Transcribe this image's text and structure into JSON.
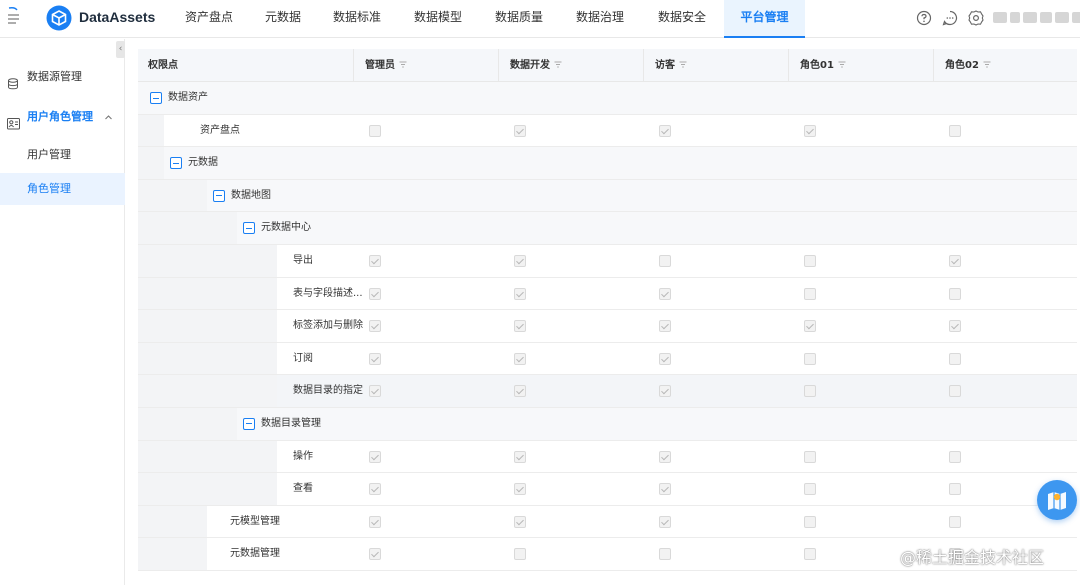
{
  "app": {
    "brand": "DataAssets"
  },
  "nav": {
    "tabs": [
      {
        "label": "资产盘点"
      },
      {
        "label": "元数据"
      },
      {
        "label": "数据标准"
      },
      {
        "label": "数据模型"
      },
      {
        "label": "数据质量"
      },
      {
        "label": "数据治理"
      },
      {
        "label": "数据安全"
      },
      {
        "label": "平台管理"
      }
    ],
    "active_tab": "平台管理",
    "tools": [
      "help-icon",
      "chat-icon",
      "settings-icon"
    ]
  },
  "sidebar": {
    "collapse_glyph": "‹",
    "items": [
      {
        "label": "数据源管理",
        "icon": "database-icon"
      },
      {
        "label": "用户角色管理",
        "icon": "user-card-icon",
        "expanded": true
      },
      {
        "label": "用户管理"
      },
      {
        "label": "角色管理",
        "active": true
      }
    ]
  },
  "table": {
    "columns": [
      {
        "label": "权限点"
      },
      {
        "label": "管理员"
      },
      {
        "label": "数据开发"
      },
      {
        "label": "访客"
      },
      {
        "label": "角色01"
      },
      {
        "label": "角色02"
      }
    ],
    "rows": [
      {
        "name": "数据资产",
        "level": 0,
        "group": true
      },
      {
        "name": "资产盘点",
        "level": 1,
        "checks": [
          false,
          true,
          true,
          true,
          false
        ]
      },
      {
        "name": "元数据",
        "level": 1,
        "group": true
      },
      {
        "name": "数据地图",
        "level": 2,
        "group": true
      },
      {
        "name": "元数据中心",
        "level": 3,
        "group": true
      },
      {
        "name": "导出",
        "level": 4,
        "checks": [
          true,
          true,
          false,
          false,
          true
        ]
      },
      {
        "name": "表与字段描述...",
        "level": 4,
        "checks": [
          true,
          true,
          true,
          false,
          false
        ]
      },
      {
        "name": "标签添加与删除",
        "level": 4,
        "checks": [
          true,
          true,
          true,
          true,
          true
        ]
      },
      {
        "name": "订阅",
        "level": 4,
        "checks": [
          true,
          true,
          true,
          false,
          false
        ]
      },
      {
        "name": "数据目录的指定",
        "level": 4,
        "checks": [
          true,
          true,
          true,
          false,
          false
        ],
        "highlight": true
      },
      {
        "name": "数据目录管理",
        "level": 3,
        "group": true
      },
      {
        "name": "操作",
        "level": 4,
        "checks": [
          true,
          true,
          true,
          false,
          false
        ]
      },
      {
        "name": "查看",
        "level": 4,
        "checks": [
          true,
          true,
          true,
          false,
          false
        ]
      },
      {
        "name": "元模型管理",
        "level": 2,
        "checks": [
          true,
          true,
          true,
          false,
          false
        ]
      },
      {
        "name": "元数据管理",
        "level": 2,
        "checks": [
          true,
          false,
          false,
          false,
          false
        ]
      }
    ]
  },
  "watermark": "@稀土掘金技术社区"
}
